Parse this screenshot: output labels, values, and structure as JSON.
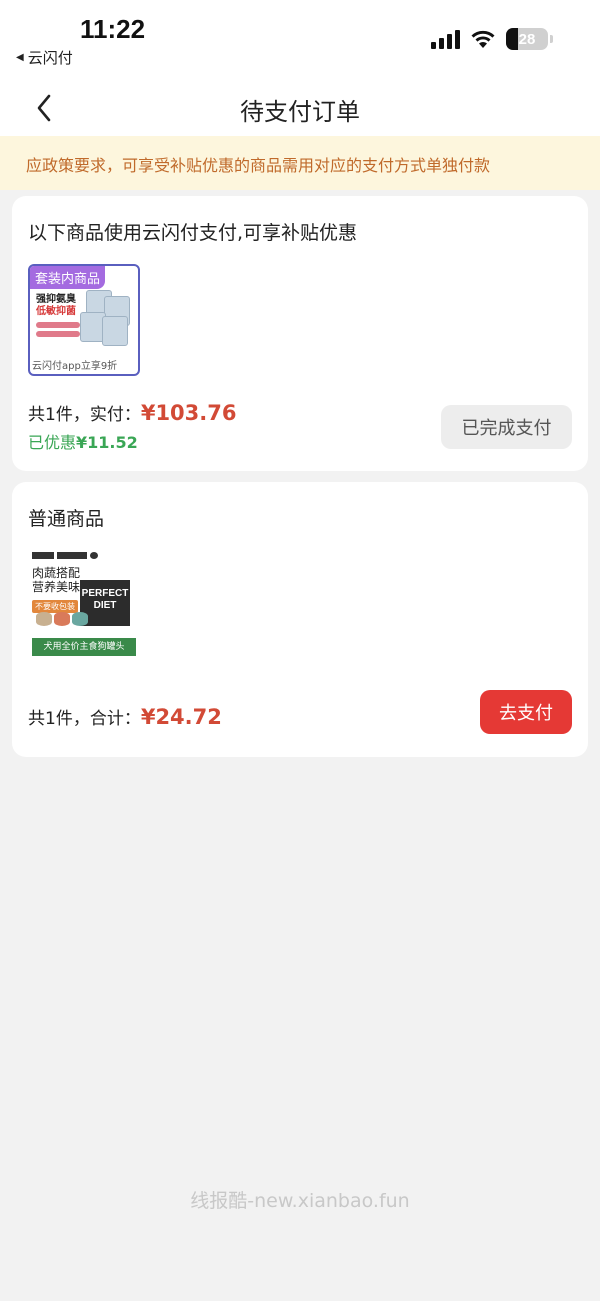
{
  "status_bar": {
    "time": "11:22",
    "back_app_label": "云闪付",
    "battery_level": "28"
  },
  "navbar": {
    "title": "待支付订单"
  },
  "notice": {
    "text": "应政策要求，可享受补贴优惠的商品需用对应的支付方式单独付款"
  },
  "orders": [
    {
      "title": "以下商品使用云闪付支付,可享补贴优惠",
      "thumb_tag": "套装内商品",
      "thumb_art_title": "强抑氨臭",
      "thumb_art_sub": "低敏抑菌",
      "thumb_caption": "云闪付app立享9折",
      "summary_prefix": "共1件，实付：",
      "price": "¥103.76",
      "discount_label": "已优惠",
      "discount_value": "¥11.52",
      "button_label": "已完成支付"
    },
    {
      "title": "普通商品",
      "thumb_art_t1": "肉蔬搭配",
      "thumb_art_t2": "营养美味",
      "thumb_box_text": "PERFECT DIET",
      "thumb_sticker": "不要收包装",
      "thumb_strip": "犬用全价主食狗罐头",
      "summary_prefix": "共1件，合计：",
      "price": "¥24.72",
      "button_label": "去支付"
    }
  ],
  "watermark": "线报酷-new.xianbao.fun",
  "colors": {
    "price": "#d24a36",
    "discount": "#3aa655",
    "pay_button": "#e53935",
    "notice_bg": "#fdf6dd",
    "notice_text": "#c06a2b"
  }
}
